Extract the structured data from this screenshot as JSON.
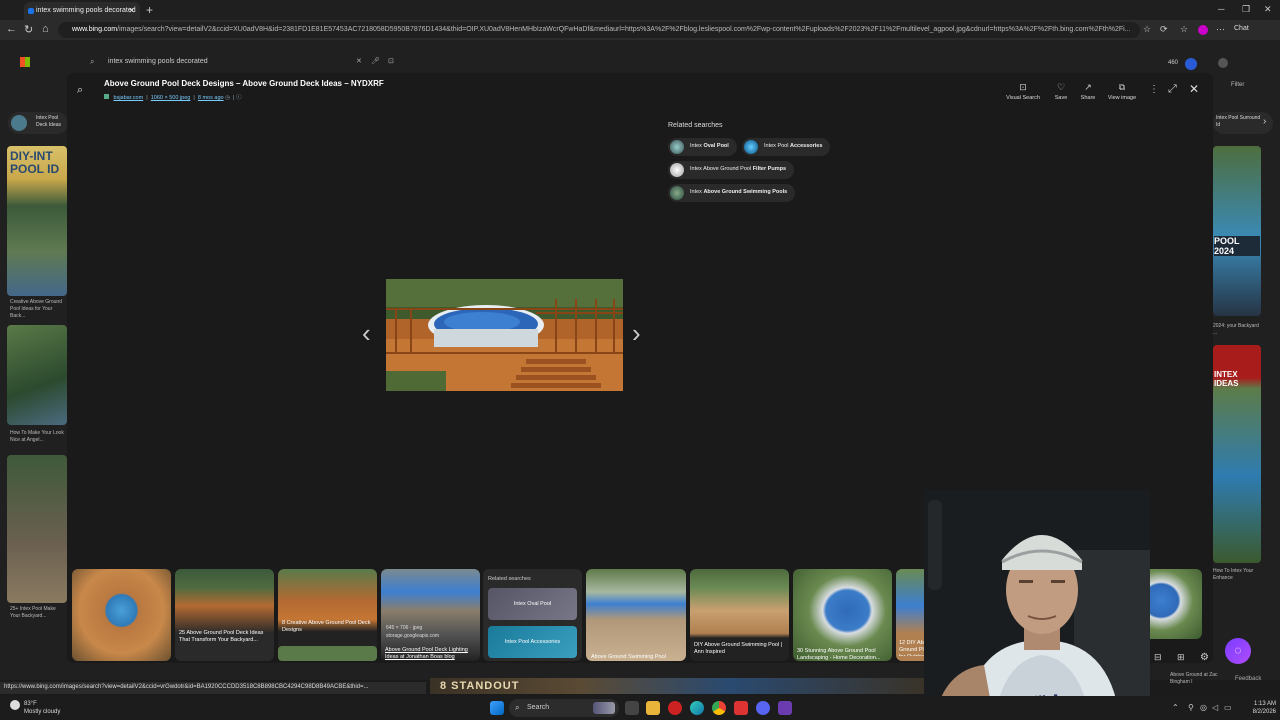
{
  "browser": {
    "tab_title": "intex swimming pools decorated",
    "url_host": "www.bing.com",
    "url_rest": "/images/search?view=detailV2&ccid=XU0adV8H&id=2381FD1E81E57453AC7218058D5950B7876D1434&thid=OIP.XU0adV8HenMHbIzaWcrQFwHaDf&mediaurl=https%3A%2F%2Fblog.lesliespool.com%2Fwp-content%2Fuploads%2F2023%2F11%2Fmultilevel_agpool.jpg&cdnurl=https%3A%2F%2Fth.bing.com%2Fth%2Fi...",
    "chat_label": "Chat"
  },
  "bing": {
    "search_query": "intex swimming pools decorated",
    "filter_label": "Filter",
    "left_chip": "Intex Pool Deck Ideas",
    "right_chip": "Intex Pool Surround Id",
    "left_captions": [
      "Creative Above Ground Pool Ideas for Your Back...",
      "How To Make Your Look Nice at Angel...",
      "25+ Intex Pool Make Your Backyard..."
    ],
    "right_captions": [
      "2024: your Backyard ...",
      "How To Intex Your Enhance",
      "Above Ground at Zac Bingham I"
    ],
    "left_banner": "DIY-INT POOL ID",
    "right_banner": "POOL 2024",
    "right_banner2": "INTEX IDEAS",
    "feedback": "Feedback"
  },
  "modal": {
    "title": "Above Ground Pool Deck Designs – Above Ground Deck Ideas – NYDXRF",
    "source": "bsjabar.com",
    "dimensions": "1060 × 500 jpeg",
    "age": "8 mos ago",
    "actions": [
      {
        "label": "Visual Search",
        "icon": "visual-search-icon"
      },
      {
        "label": "Save",
        "icon": "save-icon"
      },
      {
        "label": "Share",
        "icon": "share-icon"
      },
      {
        "label": "View image",
        "icon": "view-image-icon"
      }
    ]
  },
  "related": {
    "heading": "Related searches",
    "chips": [
      {
        "plain": "Intex ",
        "bold": "Oval Pool"
      },
      {
        "plain": "Intex Pool ",
        "bold": "Accessories"
      },
      {
        "plain": "Intex Above Ground Pool ",
        "bold": "Filter Pumps"
      },
      {
        "plain": "Intex ",
        "bold": "Above Ground Swimming Pools"
      }
    ]
  },
  "filmstrip": {
    "items": [
      {
        "caption": ""
      },
      {
        "caption": "25 Above Ground Pool Deck Ideas That Transform Your Backyard..."
      },
      {
        "caption": "8 Creative Above Ground Pool Deck Designs"
      },
      {
        "caption": "Above Ground Pool Deck Lighting Ideas at Jonathan Boas blog",
        "meta": "645 × 706 · jpeg",
        "source": "storage.googleapis.com"
      },
      {
        "caption": "Above Ground Swimming Pool"
      },
      {
        "caption": "DIY Above Ground Swimming Pool | Ann Inspired"
      },
      {
        "caption": "30 Stunning Above Ground Pool Landscaping - Home Decoration..."
      },
      {
        "caption": "12 DIY Above Ground Plans for Outdoor"
      }
    ],
    "related_heading": "Related searches",
    "related_cards": [
      "Intex Oval Pool",
      "Intex Pool Accessories"
    ],
    "bottom_banner": "8 STANDOUT"
  },
  "status_url": "https://www.bing.com/images/search?view=detailV2&ccid=vrGwdotr&id=BA1920CCCDD3518C8B898CBC4294C98D8B49ACBE&thid=...",
  "taskbar": {
    "search_label": "Search",
    "weather_temp": "83°F",
    "weather_desc": "Mostly cloudy",
    "time": "1:13 AM",
    "date": "8/2/2026"
  },
  "colors": {
    "accent": "#1a73e8",
    "modal_bg": "#1a1a1a",
    "fab": "#9b45ff"
  }
}
